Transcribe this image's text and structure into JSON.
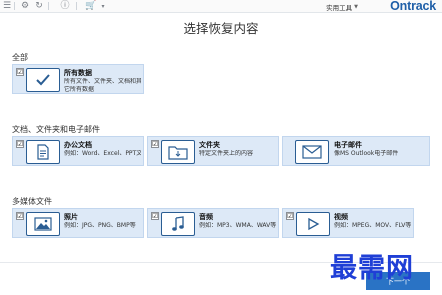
{
  "toolbar": {
    "tools_label": "实用工具",
    "brand": "Ontrack",
    "icons": [
      "menu-icon",
      "settings-icon",
      "refresh-icon",
      "info-icon",
      "cart-icon",
      "cart-dropdown-icon"
    ]
  },
  "title": "选择恢复内容",
  "sections": {
    "all": {
      "label": "全部"
    },
    "docs": {
      "label": "文档、文件夹和电子邮件"
    },
    "media": {
      "label": "多媒体文件"
    }
  },
  "cards": {
    "all_data": {
      "checked": "☑",
      "title": "所有数据",
      "line1": "所有文件、文件夹、文档和其",
      "line2": "它所有数据",
      "icon": "checkmark-icon"
    },
    "office_docs": {
      "checked": "☑",
      "title": "办公文档",
      "line1": "例如：Word、Excel、PPT文件",
      "icon": "document-icon"
    },
    "folders": {
      "checked": "☑",
      "title": "文件夹",
      "line1": "特定文件夹上的内容",
      "icon": "folder-icon"
    },
    "emails": {
      "checked": "☑",
      "title": "电子邮件",
      "line1": "像MS Outlook电子邮件",
      "icon": "envelope-icon"
    },
    "photos": {
      "checked": "☑",
      "title": "照片",
      "line1": "例如：JPG、PNG、BMP等",
      "icon": "photo-icon"
    },
    "audio": {
      "checked": "☑",
      "title": "音频",
      "line1": "例如：MP3、WMA、WAV等",
      "icon": "music-note-icon"
    },
    "video": {
      "checked": "☑",
      "title": "视频",
      "line1": "例如：MPEG、MOV、FLV等",
      "icon": "play-icon"
    }
  },
  "next_button": "下一个",
  "watermark": "最需网",
  "colors": {
    "accent": "#2a73c5",
    "card_bg": "#dde9f7",
    "brand": "#1f5fa8",
    "watermark": "#1f3fd6"
  }
}
